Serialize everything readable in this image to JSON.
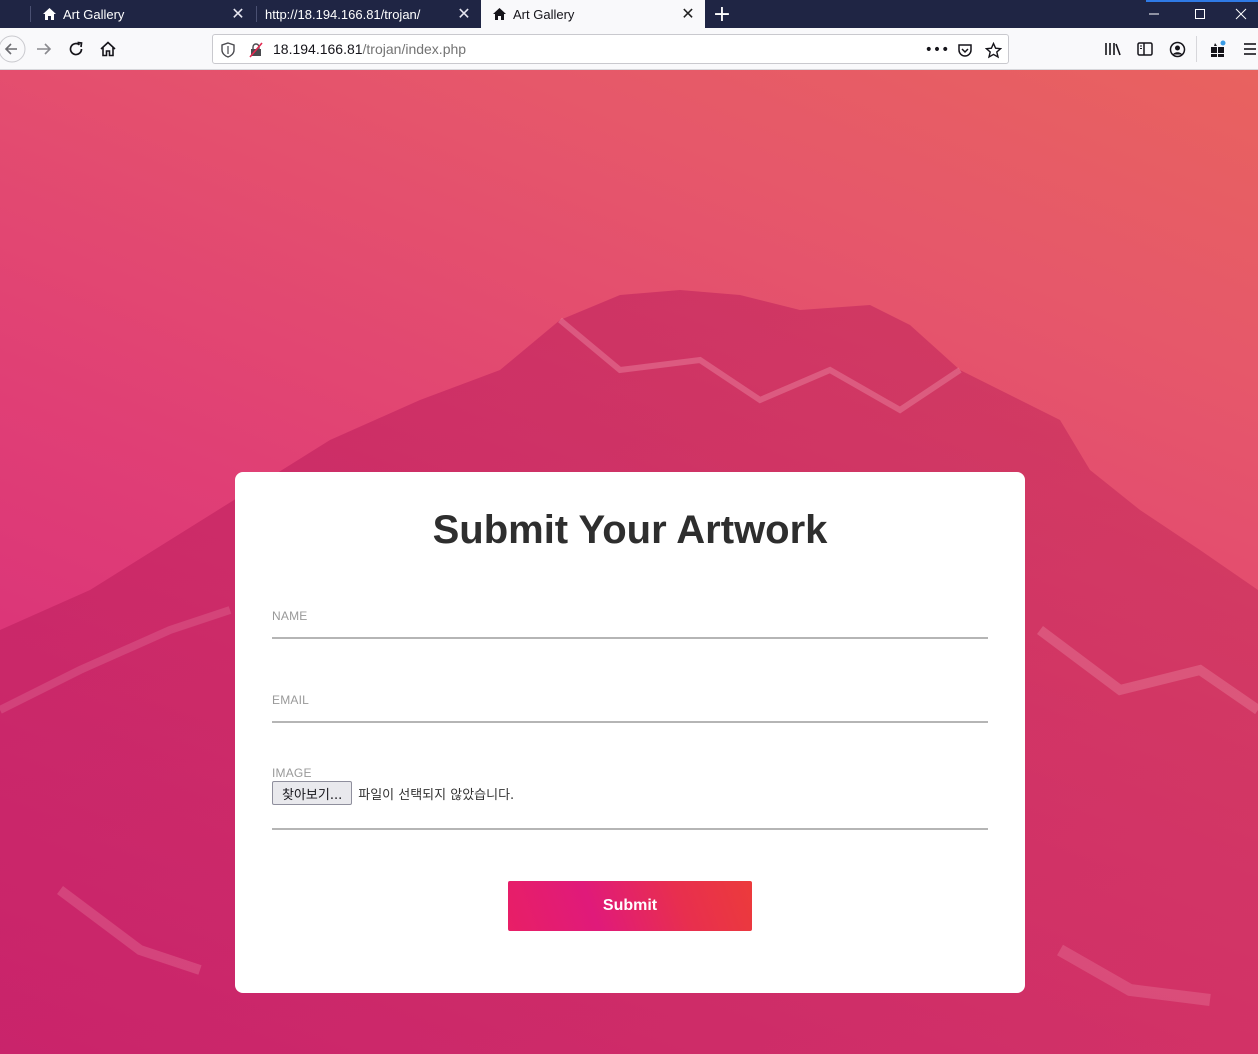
{
  "browser": {
    "tabs": [
      {
        "label": "Art Gallery",
        "icon": "home-icon",
        "active": false
      },
      {
        "label": "http://18.194.166.81/trojan/",
        "icon": "",
        "active": false
      },
      {
        "label": "Art Gallery",
        "icon": "home-icon",
        "active": true
      }
    ],
    "new_tab_symbol": "+",
    "url": {
      "host": "18.194.166.81",
      "path": "/trojan/index.php"
    },
    "page_actions_symbol": "•••"
  },
  "form": {
    "title": "Submit Your Artwork",
    "fields": {
      "name_label": "NAME",
      "email_label": "EMAIL",
      "image_label": "IMAGE"
    },
    "file_button": "찾아보기...",
    "file_status": "파일이 선택되지 않았습니다.",
    "submit_label": "Submit"
  },
  "colors": {
    "tabbar": "#1f2544",
    "page_gradient_start": "#d4267e",
    "page_gradient_end": "#e8625f",
    "card": "#ffffff",
    "title": "#2e2e2e",
    "submit_gradient_start": "#e81f66",
    "submit_gradient_end": "#ec3b3b"
  }
}
